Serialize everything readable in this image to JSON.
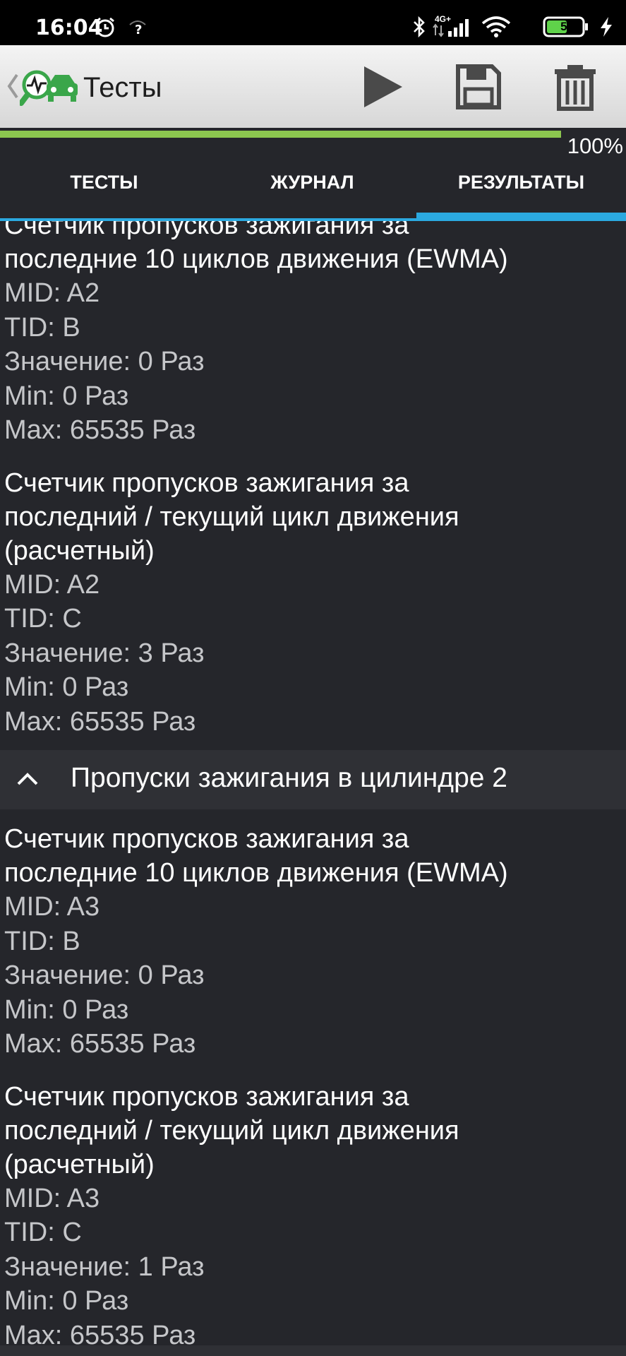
{
  "status_bar": {
    "time": "16:04",
    "alarm_icon": "alarm-clock-icon",
    "network_label": "4G+",
    "battery_level": "55"
  },
  "app_bar": {
    "title": "Тесты",
    "logo_icon": "car-diagnostic-icon",
    "actions": [
      "play-icon",
      "save-icon",
      "trash-icon"
    ]
  },
  "progress": {
    "percent_text": "100%",
    "value": 1.0
  },
  "tabs": [
    {
      "label": "ТЕСТЫ",
      "selected": false
    },
    {
      "label": "ЖУРНАЛ",
      "selected": false
    },
    {
      "label": "РЕЗУЛЬТАТЫ",
      "selected": true
    }
  ],
  "groups": [
    {
      "results": [
        {
          "title_lines": [
            "Счетчик пропусков зажигания за",
            "последние 10 циклов движения (EWMA)"
          ],
          "mid": "MID: A2",
          "tid": "TID: B",
          "value": "Значение: 0 Раз",
          "min": "Min: 0 Раз",
          "max": "Max: 65535 Раз"
        },
        {
          "title_lines": [
            "Счетчик пропусков зажигания за",
            "последний / текущий цикл движения",
            "(расчетный)"
          ],
          "mid": "MID: A2",
          "tid": "TID: C",
          "value": "Значение: 3 Раз",
          "min": "Min: 0 Раз",
          "max": "Max: 65535 Раз"
        }
      ]
    },
    {
      "header": "Пропуски зажигания в цилиндре 2",
      "results": [
        {
          "title_lines": [
            "Счетчик пропусков зажигания за",
            "последние 10 циклов движения (EWMA)"
          ],
          "mid": "MID: A3",
          "tid": "TID: B",
          "value": "Значение: 0 Раз",
          "min": "Min: 0 Раз",
          "max": "Max: 65535 Раз"
        },
        {
          "title_lines": [
            "Счетчик пропусков зажигания за",
            "последний / текущий цикл движения",
            "(расчетный)"
          ],
          "mid": "MID: A3",
          "tid": "TID: C",
          "value": "Значение: 1 Раз",
          "min": "Min: 0 Раз",
          "max": "Max: 65535 Раз"
        }
      ]
    }
  ],
  "colors": {
    "background": "#25262b",
    "progress_fill": "#8cc64f",
    "tab_indicator": "#2ba9e0",
    "header_bg": "#2f3035"
  }
}
